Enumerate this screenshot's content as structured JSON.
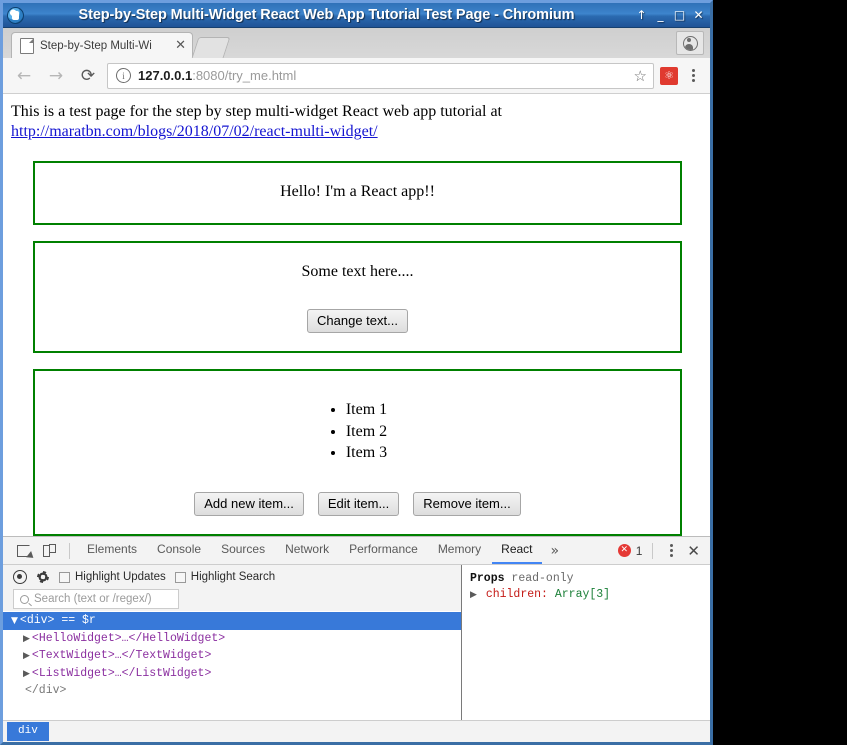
{
  "window": {
    "title": "Step-by-Step Multi-Widget React Web App Tutorial Test Page - Chromium",
    "controls": {
      "shade": "↑",
      "minimize": "_",
      "maximize": "□",
      "close": "✕"
    }
  },
  "tabstrip": {
    "tab_title": "Step-by-Step Multi-Wi",
    "close_label": "✕"
  },
  "toolbar": {
    "back": "←",
    "forward": "→",
    "reload": "⟳",
    "info_icon": "i",
    "url_host": "127.0.0.1",
    "url_rest": ":8080/try_me.html",
    "star": "☆",
    "extension_glyph": "⚛"
  },
  "page": {
    "intro_text": "This is a test page for the step by step multi-widget React web app tutorial at",
    "intro_link": "http://maratbn.com/blogs/2018/07/02/react-multi-widget/",
    "hello_widget": {
      "text": "Hello! I'm a React app!!"
    },
    "text_widget": {
      "text": "Some text here....",
      "button": "Change text..."
    },
    "list_widget": {
      "items": [
        "Item 1",
        "Item 2",
        "Item 3"
      ],
      "buttons": [
        "Add new item...",
        "Edit item...",
        "Remove item..."
      ]
    }
  },
  "devtools": {
    "tabs": [
      {
        "label": "Elements",
        "active": false
      },
      {
        "label": "Console",
        "active": false
      },
      {
        "label": "Sources",
        "active": false
      },
      {
        "label": "Network",
        "active": false
      },
      {
        "label": "Performance",
        "active": false
      },
      {
        "label": "Memory",
        "active": false
      },
      {
        "label": "React",
        "active": true
      }
    ],
    "more": "»",
    "error_count": "1",
    "error_glyph": "✕",
    "close": "✕",
    "react": {
      "highlight_updates_label": "Highlight Updates",
      "highlight_search_label": "Highlight Search",
      "search_placeholder": "Search (text or /regex/)",
      "tree": [
        {
          "arrow": "▼",
          "text": "<div> == $r",
          "selected": true
        },
        {
          "arrow": "▶",
          "text": "<HelloWidget>…</HelloWidget>",
          "selected": false
        },
        {
          "arrow": "▶",
          "text": "<TextWidget>…</TextWidget>",
          "selected": false
        },
        {
          "arrow": "▶",
          "text": "<ListWidget>…</ListWidget>",
          "selected": false
        },
        {
          "arrow": "",
          "text": "</div>",
          "selected": false
        }
      ],
      "props_title": "Props",
      "props_readonly": "read-only",
      "props_arrow": "▶",
      "props_key": "children:",
      "props_value": "Array[3]"
    },
    "breadcrumb": "div"
  },
  "colors": {
    "widget_border": "#008000",
    "link": "#1414d1",
    "selection": "#3879d9",
    "accent": "#4285f4",
    "error": "#e53935"
  }
}
